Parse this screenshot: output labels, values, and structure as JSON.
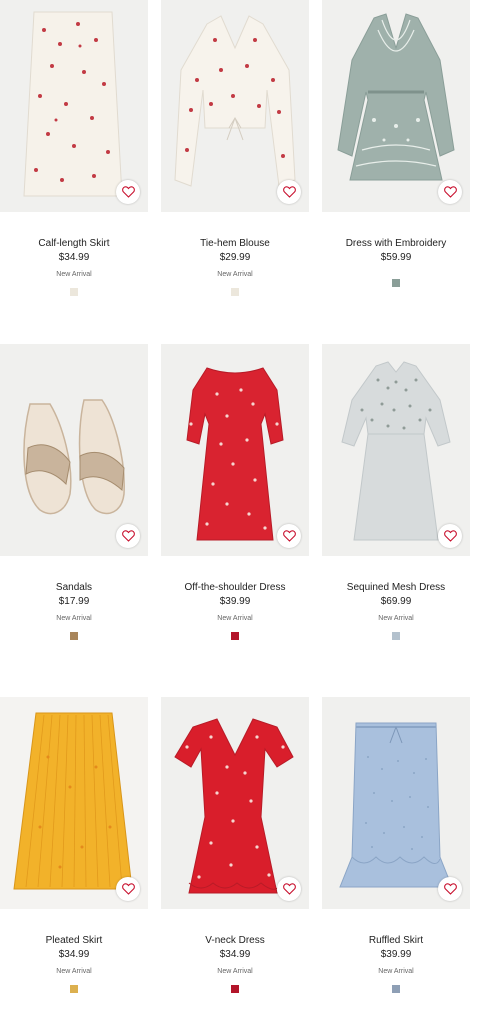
{
  "products": [
    {
      "name": "Calf-length Skirt",
      "price": "$34.99",
      "badge": "New Arrival",
      "swatch": "#ece7dc",
      "bg": "#f0f0ee",
      "garment": "#f6f2ea",
      "pattern": "#c23a44",
      "icon": "skirt-icon"
    },
    {
      "name": "Tie-hem Blouse",
      "price": "$29.99",
      "badge": "New Arrival",
      "swatch": "#ece7dc",
      "bg": "#f0f0ee",
      "garment": "#f7f3ec",
      "pattern": "#c23a44",
      "icon": "blouse-icon"
    },
    {
      "name": "Dress with Embroidery",
      "price": "$59.99",
      "badge": "",
      "swatch": "#8a9e98",
      "bg": "#f0f0ee",
      "garment": "#9fb1ab",
      "pattern": "#e8eeea",
      "icon": "dress-icon"
    },
    {
      "name": "Sandals",
      "price": "$17.99",
      "badge": "New Arrival",
      "swatch": "#a8855a",
      "bg": "#f0f0ee",
      "garment": "#c9b49c",
      "pattern": "#eee3d5",
      "icon": "sandals-icon"
    },
    {
      "name": "Off-the-shoulder Dress",
      "price": "$39.99",
      "badge": "New Arrival",
      "swatch": "#b3152a",
      "bg": "#f0f0ee",
      "garment": "#d92330",
      "pattern": "#f6d6d0",
      "icon": "dress-icon"
    },
    {
      "name": "Sequined Mesh Dress",
      "price": "$69.99",
      "badge": "New Arrival",
      "swatch": "#b3c1cd",
      "bg": "#f0f0ee",
      "garment": "#d7dbdc",
      "pattern": "#8f9b97",
      "icon": "dress-icon"
    },
    {
      "name": "Pleated Skirt",
      "price": "$34.99",
      "badge": "New Arrival",
      "swatch": "#dcb04f",
      "bg": "#f0f0ee",
      "garment": "#f2b22a",
      "pattern": "#e48a1b",
      "icon": "skirt-icon"
    },
    {
      "name": "V-neck Dress",
      "price": "$34.99",
      "badge": "New Arrival",
      "swatch": "#b3152a",
      "bg": "#f0f0ee",
      "garment": "#d91e2b",
      "pattern": "#f6d6d0",
      "icon": "dress-icon"
    },
    {
      "name": "Ruffled Skirt",
      "price": "$39.99",
      "badge": "New Arrival",
      "swatch": "#8e9fb5",
      "bg": "#f0f0ee",
      "garment": "#a9c0dd",
      "pattern": "#8ba5c6",
      "icon": "skirt-icon"
    }
  ],
  "favorite_icon": "heart-icon",
  "heart_color": "#c8102e"
}
